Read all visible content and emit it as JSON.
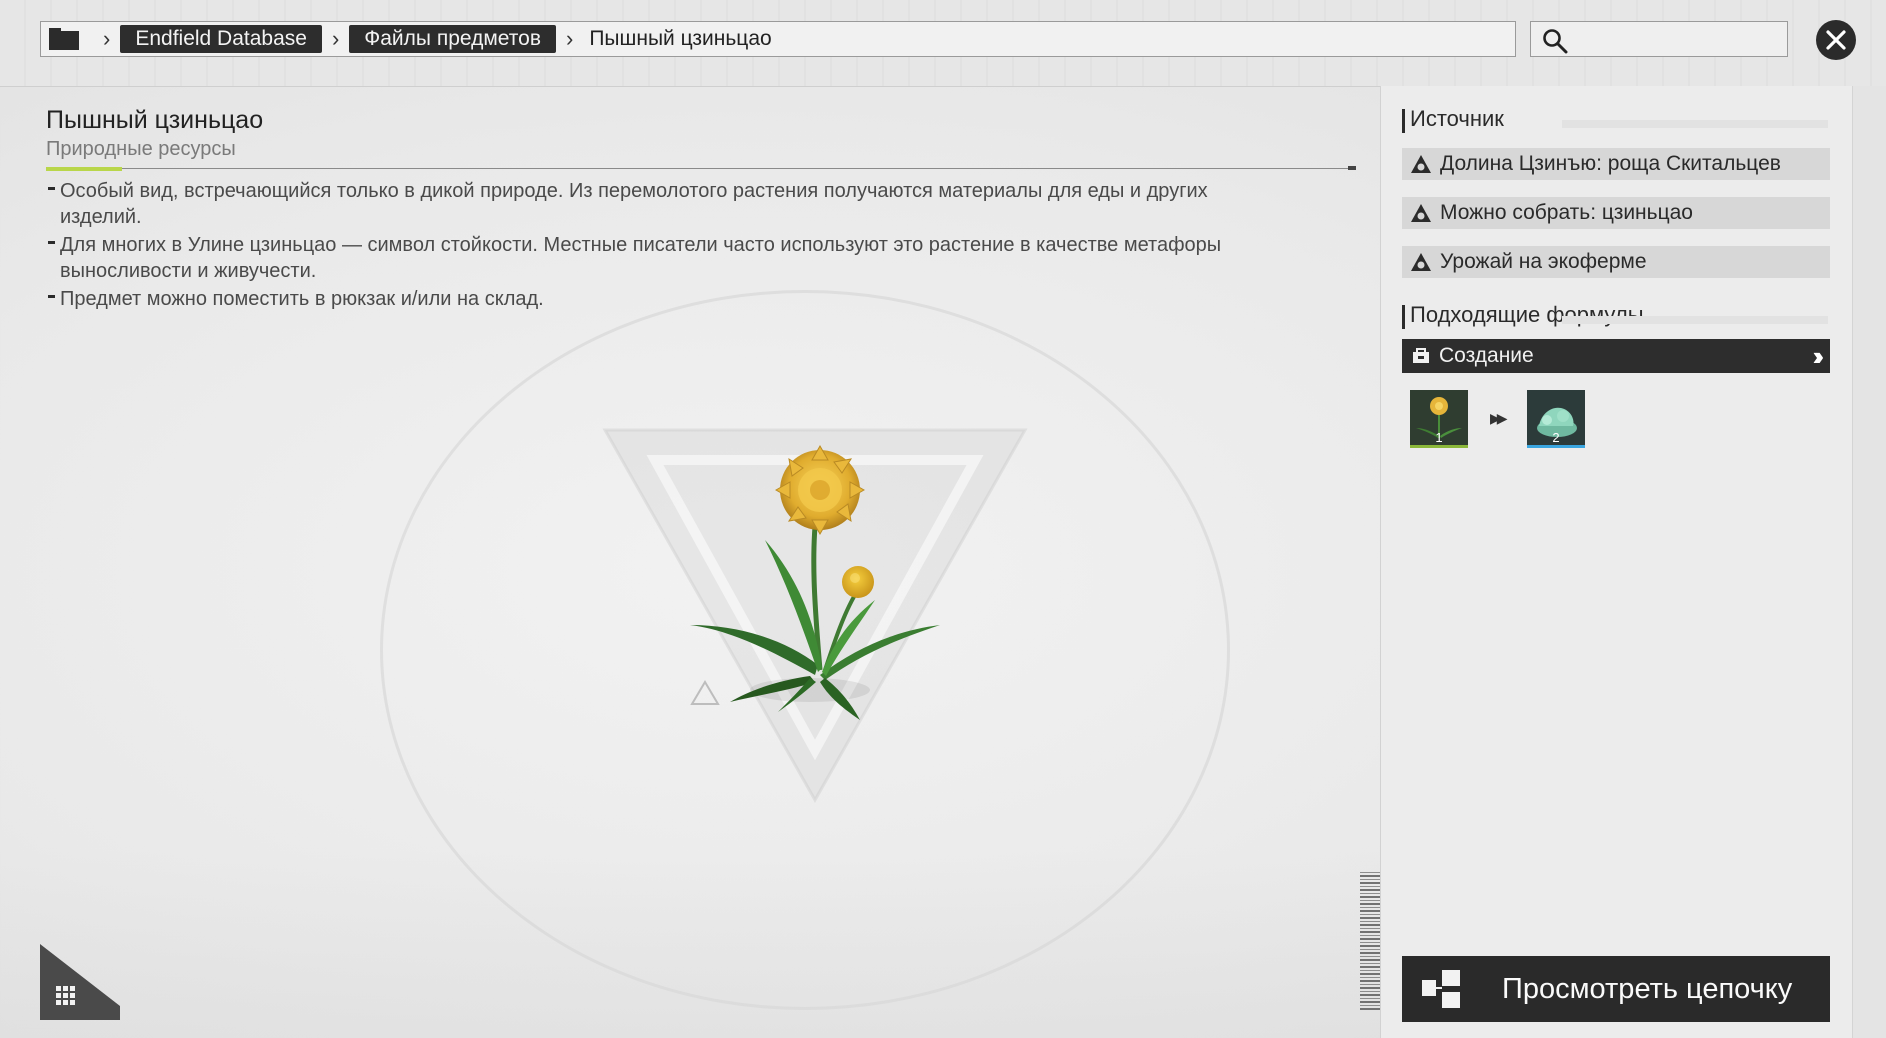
{
  "breadcrumb": {
    "root_label": "Endfield Database",
    "section_label": "Файлы предметов",
    "current_label": "Пышный цзиньцао"
  },
  "search": {
    "placeholder": ""
  },
  "item": {
    "title": "Пышный цзиньцао",
    "category": "Природные ресурсы",
    "description": [
      "Особый вид, встречающийся только в дикой природе. Из перемолотого растения получаются материалы для еды и других изделий.",
      "Для многих в Улине цзиньцао — символ стойкости. Местные писатели часто используют это растение в качестве метафоры выносливости и живучести.",
      "Предмет можно поместить в рюкзак и/или на склад."
    ]
  },
  "source": {
    "heading": "Источник",
    "items": [
      {
        "label": "Долина Цзинъю: роща Скитальцев"
      },
      {
        "label": "Можно собрать: цзиньцао"
      },
      {
        "label": "Урожай на экоферме"
      }
    ]
  },
  "formulas": {
    "heading": "Подходящие формулы",
    "craft_label": "Создание",
    "input_qty": "1",
    "output_qty": "2"
  },
  "actions": {
    "view_chain_label": "Просмотреть цепочку"
  },
  "colors": {
    "accent_green": "#b9d64a",
    "dark": "#2d2d2d",
    "input_rarity": "#8bb83a",
    "output_rarity": "#3aa6e0"
  }
}
